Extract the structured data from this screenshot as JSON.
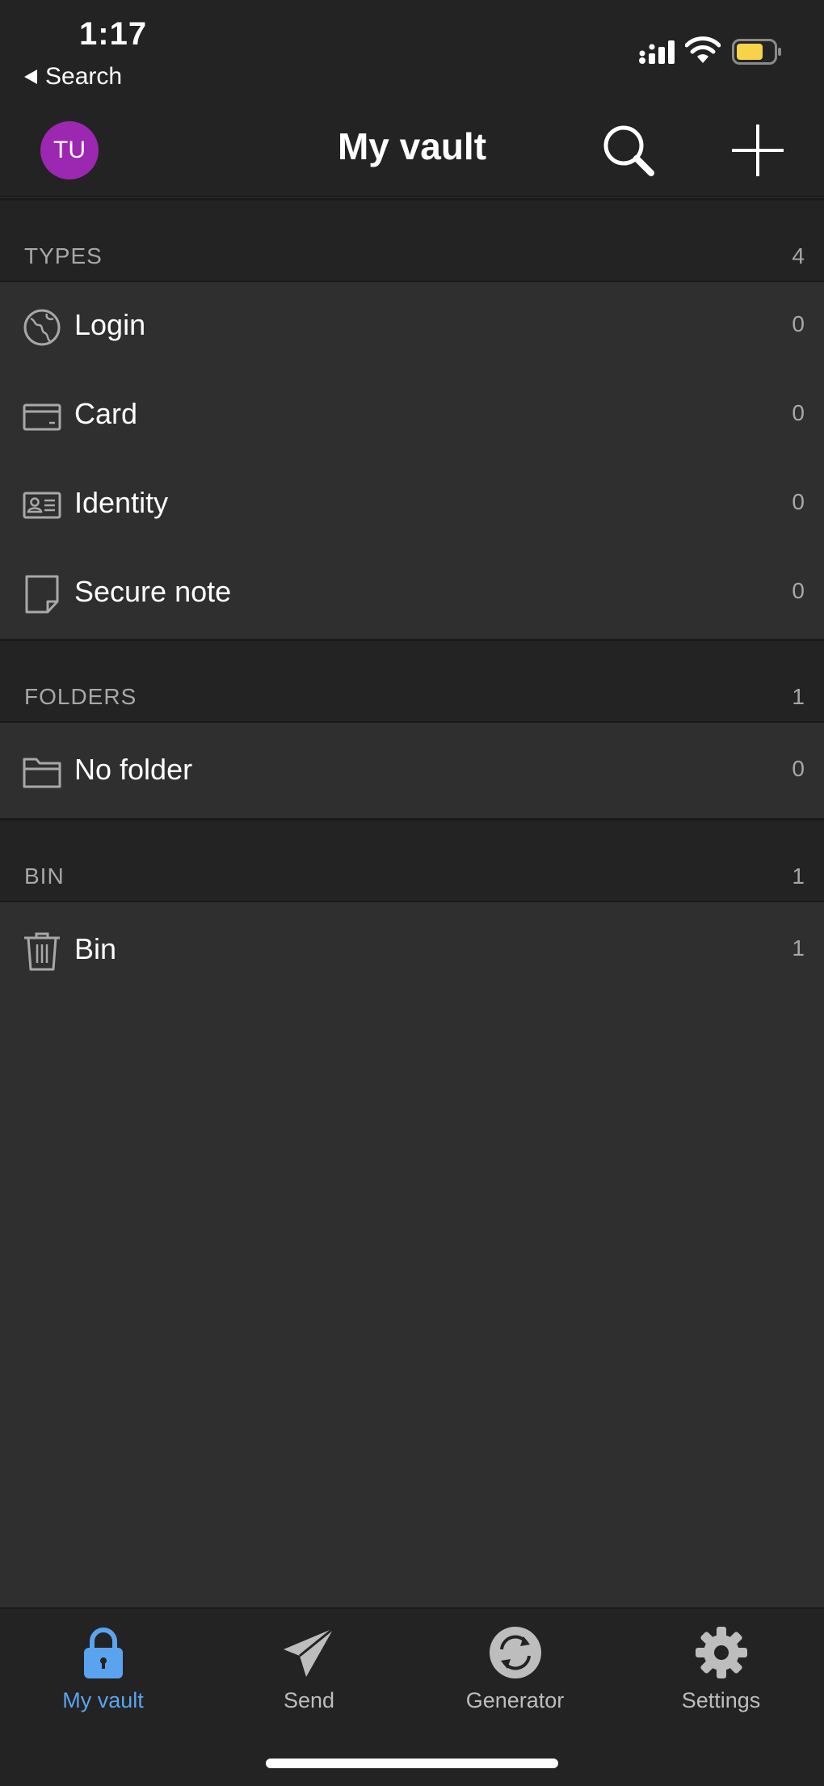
{
  "status_bar": {
    "time": "1:17",
    "back_label": "Search"
  },
  "nav": {
    "avatar_initials": "TU",
    "avatar_color": "#9c27b0",
    "title": "My vault"
  },
  "sections": {
    "types": {
      "header": "TYPES",
      "count": "4",
      "items": [
        {
          "label": "Login",
          "count": "0",
          "icon": "globe-icon"
        },
        {
          "label": "Card",
          "count": "0",
          "icon": "credit-card-icon"
        },
        {
          "label": "Identity",
          "count": "0",
          "icon": "id-card-icon"
        },
        {
          "label": "Secure note",
          "count": "0",
          "icon": "note-icon"
        }
      ]
    },
    "folders": {
      "header": "FOLDERS",
      "count": "1",
      "items": [
        {
          "label": "No folder",
          "count": "0",
          "icon": "folder-icon"
        }
      ]
    },
    "bin": {
      "header": "BIN",
      "count": "1",
      "items": [
        {
          "label": "Bin",
          "count": "1",
          "icon": "trash-icon"
        }
      ]
    }
  },
  "tab_bar": {
    "active_color": "#5aa4ef",
    "tabs": [
      {
        "label": "My vault",
        "icon": "lock-icon",
        "active": true
      },
      {
        "label": "Send",
        "icon": "paper-plane-icon",
        "active": false
      },
      {
        "label": "Generator",
        "icon": "refresh-icon",
        "active": false
      },
      {
        "label": "Settings",
        "icon": "gear-icon",
        "active": false
      }
    ]
  }
}
